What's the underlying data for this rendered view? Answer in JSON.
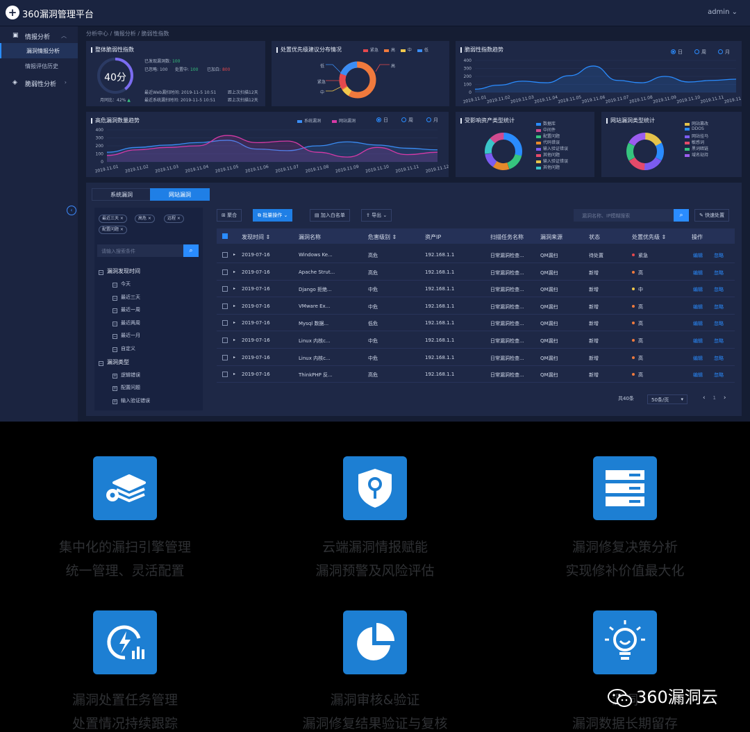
{
  "app": {
    "title": "360漏洞管理平台",
    "user": "admin"
  },
  "sidebar": {
    "groups": [
      {
        "label": "情报分析",
        "items": [
          {
            "label": "漏洞情报分析",
            "active": true
          },
          {
            "label": "情报评估历史",
            "active": false
          }
        ]
      },
      {
        "label": "脆弱性分析"
      }
    ]
  },
  "breadcrumb": "分析中心 / 情报分析 / 脆弱性指数",
  "overall": {
    "title": "整体脆弱性指数",
    "score": "40分",
    "weekly_label": "月同比：",
    "weekly_value": "42%",
    "found_label": "已发现漏洞数:",
    "found_value": "100",
    "ignored_label": "已忽略:",
    "ignored_value": "100",
    "handling_label": "处置中:",
    "handling_value": "100",
    "added_label": "已加白:",
    "added_value": "800",
    "web_scan_label": "最近Web漏扫时间:",
    "web_scan_time": "2019-11-5 10:51",
    "web_since": "距上次扫描12天",
    "sys_scan_label": "最近系统漏扫时间:",
    "sys_scan_time": "2019-11-5 10:51",
    "sys_since": "距上次扫描12天"
  },
  "priority": {
    "title": "处置优先级建议分布情况",
    "legend": [
      "紧急",
      "高",
      "中",
      "低"
    ],
    "colors": [
      "#e5484d",
      "#f07a3d",
      "#f2c94c",
      "#3a8df5"
    ],
    "callouts": [
      "低",
      "紧急",
      "中",
      "高"
    ]
  },
  "vuln_trend": {
    "title": "脆弱性指数趋势",
    "radios": [
      "日",
      "周",
      "月"
    ],
    "chart_data": {
      "type": "line",
      "categories": [
        "2019.11.01",
        "2019.11.02",
        "2019.11.03",
        "2019.11.04",
        "2019.11.05",
        "2019.11.06",
        "2019.11.07",
        "2019.11.08",
        "2019.11.09",
        "2019.11.10",
        "2019.11.11",
        "2019.11.12"
      ],
      "values": [
        40,
        90,
        140,
        120,
        210,
        330,
        150,
        120,
        200,
        130,
        150,
        165
      ],
      "y_ticks": [
        0,
        100,
        200,
        300,
        400
      ],
      "ylim": [
        0,
        400
      ]
    }
  },
  "high_trend": {
    "title": "高危漏洞数量趋势",
    "legend": [
      "系统漏洞",
      "网站漏洞"
    ],
    "radios": [
      "日",
      "周",
      "月"
    ],
    "chart_data": {
      "type": "area",
      "categories": [
        "2019.11.01",
        "2019.11.02",
        "2019.11.03",
        "2019.11.04",
        "2019.11.05",
        "2019.11.06",
        "2019.11.07",
        "2019.11.08",
        "2019.11.09",
        "2019.11.10",
        "2019.11.11",
        "2019.11.12"
      ],
      "series": [
        {
          "name": "系统漏洞",
          "color": "#3a8df5",
          "values": [
            120,
            180,
            210,
            240,
            270,
            160,
            140,
            200,
            250,
            210,
            170,
            150
          ]
        },
        {
          "name": "网站漏洞",
          "color": "#d63aa6",
          "values": [
            80,
            150,
            180,
            200,
            330,
            240,
            260,
            120,
            60,
            180,
            90,
            120
          ]
        }
      ],
      "y_ticks": [
        0,
        100,
        200,
        300,
        400
      ],
      "ylim": [
        0,
        400
      ]
    }
  },
  "asset_types": {
    "title": "受影响资产类型统计",
    "items": [
      {
        "label": "数据库",
        "color": "#2a8cff"
      },
      {
        "label": "中间件",
        "color": "#d14b8f"
      },
      {
        "label": "配置问题",
        "color": "#36c47e"
      },
      {
        "label": "代码错误",
        "color": "#e58a2b"
      },
      {
        "label": "输入验证错误",
        "color": "#7b5cf0"
      },
      {
        "label": "其他问题",
        "color": "#e54a6a"
      },
      {
        "label": "输入验证错误",
        "color": "#e5c24a"
      },
      {
        "label": "其他问题",
        "color": "#3ac5c9"
      }
    ]
  },
  "web_types": {
    "title": "网站漏洞类型统计",
    "items": [
      {
        "label": "网站篡改",
        "color": "#e5c24a"
      },
      {
        "label": "DDOS",
        "color": "#2a8cff"
      },
      {
        "label": "网站挂马",
        "color": "#7b5cf0"
      },
      {
        "label": "敏感词",
        "color": "#e54a6a"
      },
      {
        "label": "黑词暗链",
        "color": "#36c47e"
      },
      {
        "label": "域名劫持",
        "color": "#9b5cf0"
      }
    ]
  },
  "tabs": [
    "系统漏洞",
    "网站漏洞"
  ],
  "filters": {
    "chips": [
      "最近三天",
      "高危",
      "远程",
      "配置问题"
    ],
    "search_placeholder": "请输入搜索条件",
    "tree": [
      {
        "label": "漏洞发现时间",
        "children": [
          "今天",
          "最近三天",
          "最近一周",
          "最近两周",
          "最近一月",
          "自定义"
        ]
      },
      {
        "label": "漏洞类型",
        "children": [
          "逻辑错误",
          "配置问题",
          "输入验证错误"
        ]
      }
    ]
  },
  "toolbar": {
    "aggregate": "聚合",
    "batch": "批量操作",
    "whitelist": "加入白名单",
    "export": "导出",
    "search_placeholder": "漏洞名称、IP模糊搜索",
    "quick": "快速处置"
  },
  "table": {
    "headers": [
      "发现时间",
      "漏洞名称",
      "危害级别",
      "资产IP",
      "扫描任务名称",
      "漏洞来源",
      "状态",
      "处置优先级",
      "操作"
    ],
    "rows": [
      {
        "date": "2019-07-16",
        "name": "Windows Ke...",
        "level": "高危",
        "ip": "192.168.1.1",
        "task": "日常漏洞检查...",
        "source": "QM漏扫",
        "status": "待处置",
        "priority": "紧急",
        "pcolor": "#e5484d"
      },
      {
        "date": "2019-07-16",
        "name": "Apache Strut...",
        "level": "高危",
        "ip": "192.168.1.1",
        "task": "日常漏洞检查...",
        "source": "QM漏扫",
        "status": "新增",
        "priority": "高",
        "pcolor": "#f07a3d"
      },
      {
        "date": "2019-07-16",
        "name": "Django 拒绝...",
        "level": "中危",
        "ip": "192.168.1.1",
        "task": "日常漏洞检查...",
        "source": "QM漏扫",
        "status": "新增",
        "priority": "中",
        "pcolor": "#f2c94c"
      },
      {
        "date": "2019-07-16",
        "name": "VMware Ex...",
        "level": "中危",
        "ip": "192.168.1.1",
        "task": "日常漏洞检查...",
        "source": "QM漏扫",
        "status": "新增",
        "priority": "高",
        "pcolor": "#f07a3d"
      },
      {
        "date": "2019-07-16",
        "name": "Mysql 数据...",
        "level": "低危",
        "ip": "192.168.1.1",
        "task": "日常漏洞检查...",
        "source": "QM漏扫",
        "status": "新增",
        "priority": "高",
        "pcolor": "#f07a3d"
      },
      {
        "date": "2019-07-16",
        "name": "Linux 内核c...",
        "level": "中危",
        "ip": "192.168.1.1",
        "task": "日常漏洞检查...",
        "source": "QM漏扫",
        "status": "新增",
        "priority": "高",
        "pcolor": "#f07a3d"
      },
      {
        "date": "2019-07-16",
        "name": "Linux 内核c...",
        "level": "中危",
        "ip": "192.168.1.1",
        "task": "日常漏洞检查...",
        "source": "QM漏扫",
        "status": "新增",
        "priority": "高",
        "pcolor": "#f07a3d"
      },
      {
        "date": "2019-07-16",
        "name": "ThinkPHP 反...",
        "level": "高危",
        "ip": "192.168.1.1",
        "task": "日常漏洞检查...",
        "source": "QM漏扫",
        "status": "新增",
        "priority": "高",
        "pcolor": "#f07a3d"
      }
    ],
    "actions": [
      "编辑",
      "忽略"
    ]
  },
  "pagination": {
    "total": "共40条",
    "page_size": "50条/页",
    "page": "1"
  },
  "features": [
    {
      "icon": "layers-gear-icon",
      "line1": "集中化的漏扫引擎管理",
      "line2": "统一管理、灵活配置"
    },
    {
      "icon": "shield-key-icon",
      "line1": "云端漏洞情报赋能",
      "line2": "漏洞预警及风险评估"
    },
    {
      "icon": "server-icon",
      "line1": "漏洞修复决策分析",
      "line2": "实现修补价值最大化"
    },
    {
      "icon": "bolt-chart-icon",
      "line1": "漏洞处置任务管理",
      "line2": "处置情况持续跟踪"
    },
    {
      "icon": "pie-chart-icon",
      "line1": "漏洞审核&验证",
      "line2": "漏洞修复结果验证与复核"
    },
    {
      "icon": "lightbulb-icon",
      "line1": "漏洞",
      "line2": "漏洞数据长期留存"
    }
  ],
  "watermark": "360漏洞云"
}
